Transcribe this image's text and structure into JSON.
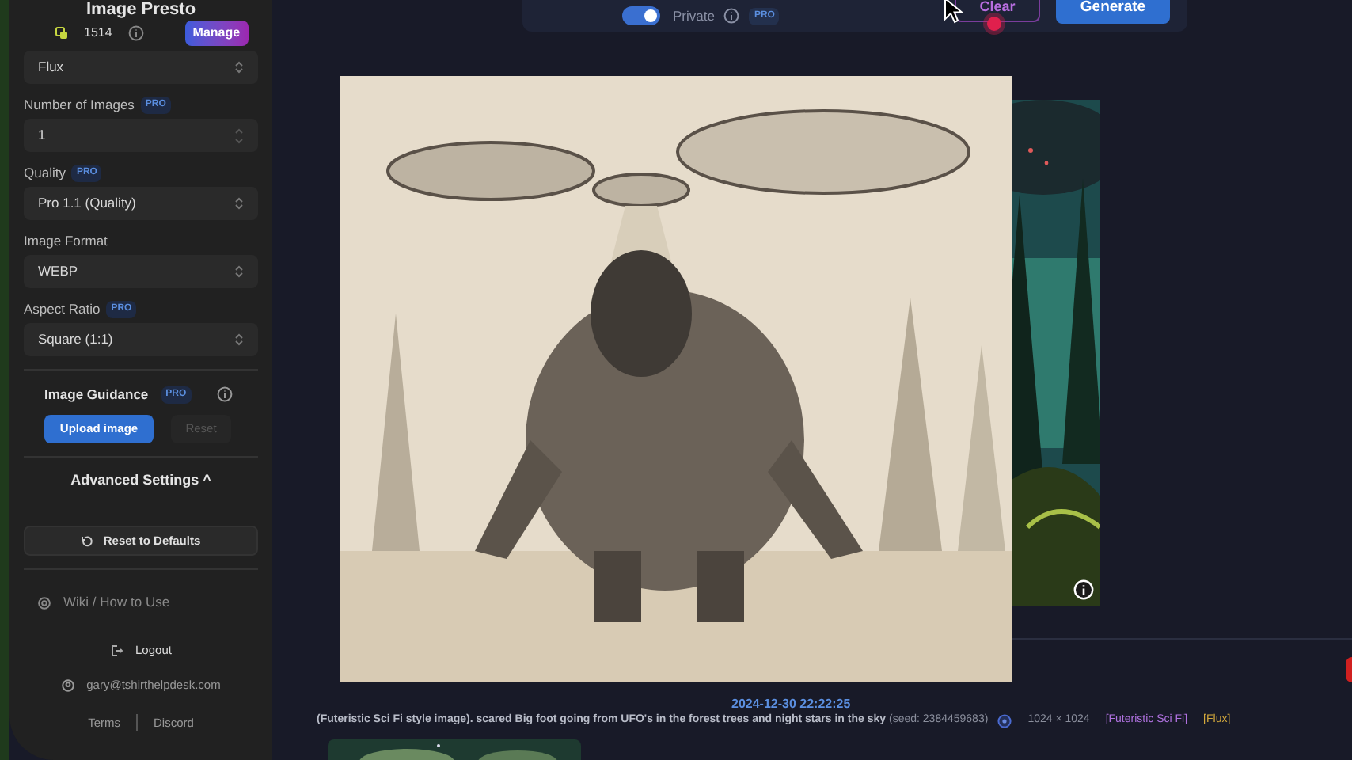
{
  "app_title": "Image Presto",
  "credits": {
    "count": "1514",
    "button": "Manage"
  },
  "fields": [
    {
      "kind": "select",
      "value": "Flux"
    },
    {
      "kind": "number",
      "label": "Number of Images",
      "badge": "PRO",
      "value": "1"
    },
    {
      "kind": "select",
      "label": "Quality",
      "badge": "PRO",
      "value": "Pro 1.1 (Quality)"
    },
    {
      "kind": "select",
      "label": "Image Format",
      "value": "WEBP"
    },
    {
      "kind": "select",
      "label": "Aspect Ratio",
      "badge": "PRO",
      "value": "Square (1:1)"
    }
  ],
  "image_guidance": {
    "label": "Image Guidance",
    "badge": "PRO",
    "upload": "Upload image",
    "reset": "Reset",
    "reset_disabled": true
  },
  "advanced_settings": "Advanced Settings ^",
  "reset_defaults": "Reset to Defaults",
  "links": {
    "wiki": "Wiki / How to Use",
    "logout": "Logout",
    "email": "gary@tshirthelpdesk.com",
    "terms": "Terms",
    "discord": "Discord"
  },
  "toolbar": {
    "private_on": true,
    "private_label": "Private",
    "badge": "PRO",
    "clear": "Clear",
    "generate": "Generate"
  },
  "result": {
    "date": "2024-12-30 22:22:25",
    "prompt": "(Futeristic Sci Fi style image). scared Big foot going from UFO's in the forest trees and night stars in the sky",
    "seed": "(seed: 2384459683)",
    "size": "1024 × 1024",
    "tags": [
      {
        "text": "[Futeristic Sci Fi]",
        "color": "#b072e0"
      },
      {
        "text": "[Flux]",
        "color": "#d4a93c"
      }
    ]
  }
}
